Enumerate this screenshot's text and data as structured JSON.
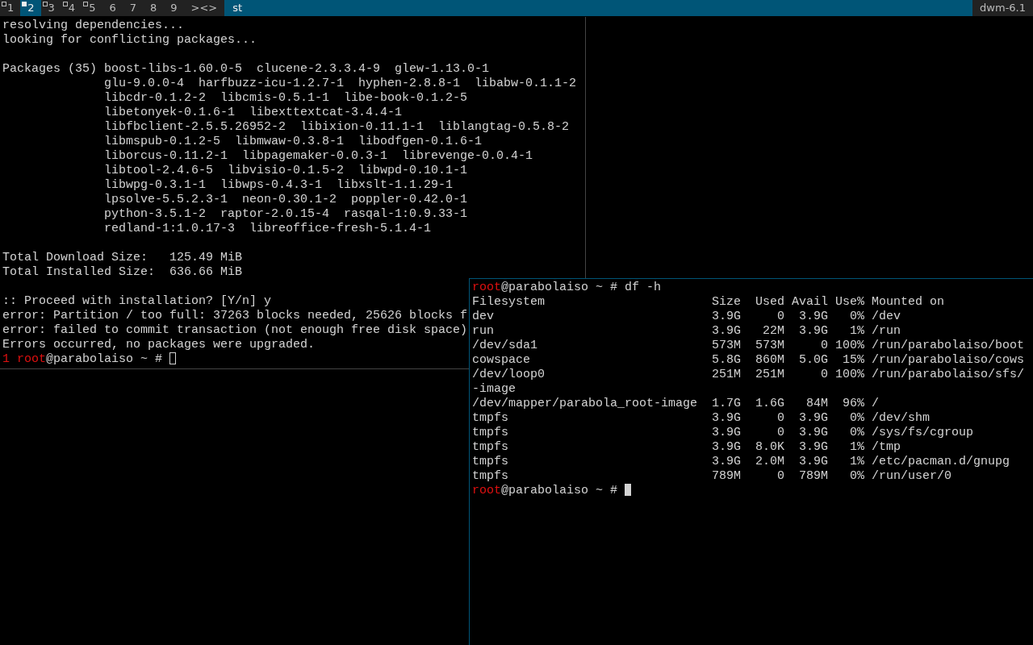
{
  "bar": {
    "tags": [
      {
        "label": "1",
        "selected": false,
        "occupied": true
      },
      {
        "label": "2",
        "selected": true,
        "occupied": true
      },
      {
        "label": "3",
        "selected": false,
        "occupied": true
      },
      {
        "label": "4",
        "selected": false,
        "occupied": true
      },
      {
        "label": "5",
        "selected": false,
        "occupied": true
      },
      {
        "label": "6",
        "selected": false,
        "occupied": false
      },
      {
        "label": "7",
        "selected": false,
        "occupied": false
      },
      {
        "label": "8",
        "selected": false,
        "occupied": false
      },
      {
        "label": "9",
        "selected": false,
        "occupied": false
      }
    ],
    "layout": "><>",
    "title": "st",
    "status": "dwm-6.1"
  },
  "windows": [
    {
      "focused": false,
      "lines": [
        {
          "kind": "text",
          "text": "resolving dependencies..."
        },
        {
          "kind": "text",
          "text": "looking for conflicting packages..."
        },
        {
          "kind": "blank"
        },
        {
          "kind": "text",
          "text": "Packages (35) boost-libs-1.60.0-5  clucene-2.3.3.4-9  glew-1.13.0-1"
        },
        {
          "kind": "text",
          "text": "              glu-9.0.0-4  harfbuzz-icu-1.2.7-1  hyphen-2.8.8-1  libabw-0.1.1-2"
        },
        {
          "kind": "text",
          "text": "              libcdr-0.1.2-2  libcmis-0.5.1-1  libe-book-0.1.2-5"
        },
        {
          "kind": "text",
          "text": "              libetonyek-0.1.6-1  libexttextcat-3.4.4-1"
        },
        {
          "kind": "text",
          "text": "              libfbclient-2.5.5.26952-2  libixion-0.11.1-1  liblangtag-0.5.8-2"
        },
        {
          "kind": "text",
          "text": "              libmspub-0.1.2-5  libmwaw-0.3.8-1  libodfgen-0.1.6-1"
        },
        {
          "kind": "text",
          "text": "              liborcus-0.11.2-1  libpagemaker-0.0.3-1  librevenge-0.0.4-1"
        },
        {
          "kind": "text",
          "text": "              libtool-2.4.6-5  libvisio-0.1.5-2  libwpd-0.10.1-1"
        },
        {
          "kind": "text",
          "text": "              libwpg-0.3.1-1  libwps-0.4.3-1  libxslt-1.1.29-1"
        },
        {
          "kind": "text",
          "text": "              lpsolve-5.5.2.3-1  neon-0.30.1-2  poppler-0.42.0-1"
        },
        {
          "kind": "text",
          "text": "              python-3.5.1-2  raptor-2.0.15-4  rasqal-1:0.9.33-1"
        },
        {
          "kind": "text",
          "text": "              redland-1:1.0.17-3  libreoffice-fresh-5.1.4-1"
        },
        {
          "kind": "blank"
        },
        {
          "kind": "text",
          "text": "Total Download Size:   125.49 MiB"
        },
        {
          "kind": "text",
          "text": "Total Installed Size:  636.66 MiB"
        },
        {
          "kind": "blank"
        },
        {
          "kind": "text",
          "text": ":: Proceed with installation? [Y/n] y"
        },
        {
          "kind": "text",
          "text": "error: Partition / too full: 37263 blocks needed, 25626 blocks f"
        },
        {
          "kind": "text",
          "text": "error: failed to commit transaction (not enough free disk space)"
        },
        {
          "kind": "text",
          "text": "Errors occurred, no packages were upgraded."
        },
        {
          "kind": "prompt",
          "status": "1",
          "user": "root",
          "host": "@parabolaiso ~ #"
        }
      ]
    },
    {
      "focused": true,
      "lines": [
        {
          "kind": "prompt",
          "user": "root",
          "host": "@parabolaiso ~ #",
          "command": "df -h"
        },
        {
          "kind": "table",
          "columns": [
            "Filesystem",
            "Size",
            "Used",
            "Avail",
            "Use%",
            "Mounted on"
          ],
          "rows": [
            {
              "cells": [
                "dev",
                "3.9G",
                "0",
                "3.9G",
                "0%",
                "/dev"
              ]
            },
            {
              "cells": [
                "run",
                "3.9G",
                "22M",
                "3.9G",
                "1%",
                "/run"
              ]
            },
            {
              "cells": [
                "/dev/sda1",
                "573M",
                "573M",
                "0",
                "100%",
                "/run/parabolaiso/boot"
              ]
            },
            {
              "cells": [
                "cowspace",
                "5.8G",
                "860M",
                "5.0G",
                "15%",
                "/run/parabolaiso/cows"
              ]
            },
            {
              "cells": [
                "/dev/loop0",
                "251M",
                "251M",
                "0",
                "100%",
                "/run/parabolaiso/sfs/"
              ],
              "continuation": "-image"
            },
            {
              "cells": [
                "/dev/mapper/parabola_root-image",
                "1.7G",
                "1.6G",
                "84M",
                "96%",
                "/"
              ]
            },
            {
              "cells": [
                "tmpfs",
                "3.9G",
                "0",
                "3.9G",
                "0%",
                "/dev/shm"
              ]
            },
            {
              "cells": [
                "tmpfs",
                "3.9G",
                "0",
                "3.9G",
                "0%",
                "/sys/fs/cgroup"
              ]
            },
            {
              "cells": [
                "tmpfs",
                "3.9G",
                "8.0K",
                "3.9G",
                "1%",
                "/tmp"
              ]
            },
            {
              "cells": [
                "tmpfs",
                "3.9G",
                "2.0M",
                "3.9G",
                "1%",
                "/etc/pacman.d/gnupg"
              ]
            },
            {
              "cells": [
                "tmpfs",
                "789M",
                "0",
                "789M",
                "0%",
                "/run/user/0"
              ]
            }
          ]
        },
        {
          "kind": "prompt",
          "user": "root",
          "host": "@parabolaiso ~ #"
        }
      ]
    }
  ]
}
